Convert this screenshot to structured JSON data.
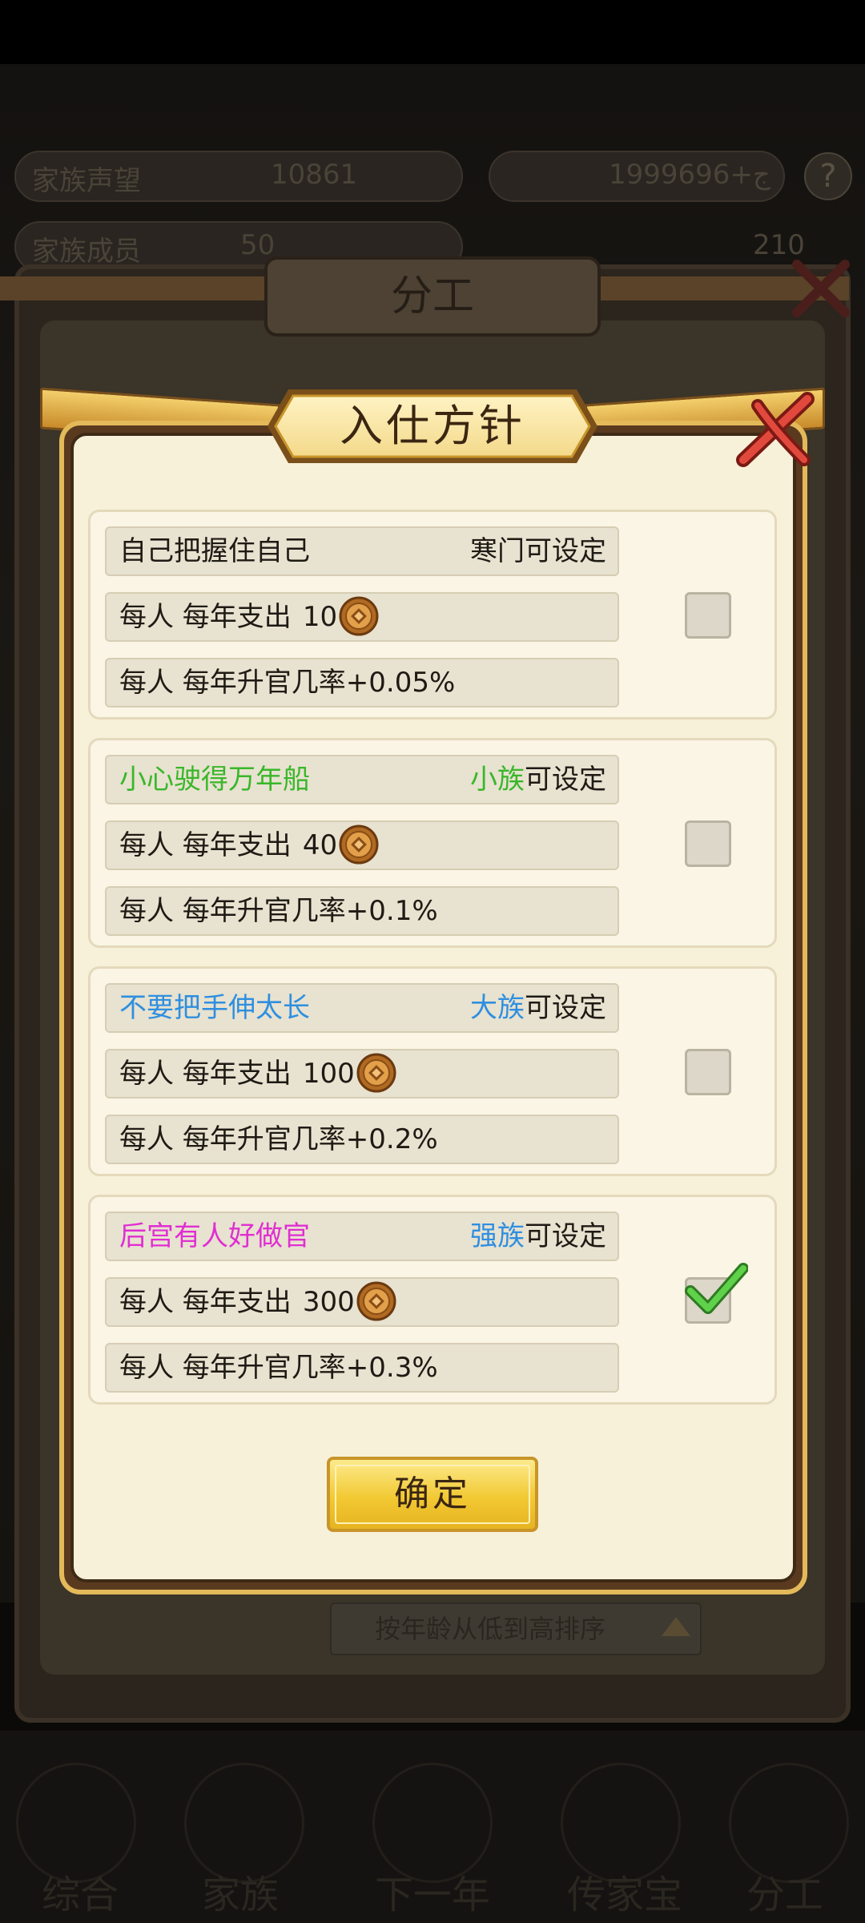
{
  "background": {
    "stats": {
      "fame_label": "家族声望",
      "fame_value": "10861",
      "coins_value": "1999ج+696",
      "members_label": "家族成员",
      "members_value": "50",
      "right_value": "210"
    },
    "panel_title": "分工",
    "sort_label": "按年龄从低到高排序",
    "nav": [
      "综合",
      "家族",
      "下一年",
      "传家宝",
      "分工"
    ]
  },
  "dialog": {
    "title": "入仕方针",
    "confirm_label": "确定",
    "options": [
      {
        "name": "自己把握住自己",
        "name_color": "#1e1a14",
        "tier": "寒门",
        "tier_color": "#1e1a14",
        "settable": "可设定",
        "cost_prefix": "每人 每年支出",
        "cost": "10",
        "benefit": "每人 每年升官几率+0.05%",
        "checked": false
      },
      {
        "name": "小心驶得万年船",
        "name_color": "#39b72a",
        "tier": "小族",
        "tier_color": "#39b72a",
        "settable": "可设定",
        "cost_prefix": "每人 每年支出",
        "cost": "40",
        "benefit": "每人 每年升官几率+0.1%",
        "checked": false
      },
      {
        "name": "不要把手伸太长",
        "name_color": "#2f8fe0",
        "tier": "大族",
        "tier_color": "#2f8fe0",
        "settable": "可设定",
        "cost_prefix": "每人 每年支出",
        "cost": "100",
        "benefit": "每人 每年升官几率+0.2%",
        "checked": false
      },
      {
        "name": "后宫有人好做官",
        "name_color": "#e02fd2",
        "tier": "强族",
        "tier_color": "#2f8fe0",
        "settable": "可设定",
        "cost_prefix": "每人 每年支出",
        "cost": "300",
        "benefit": "每人 每年升官几率+0.3%",
        "checked": true
      }
    ]
  }
}
